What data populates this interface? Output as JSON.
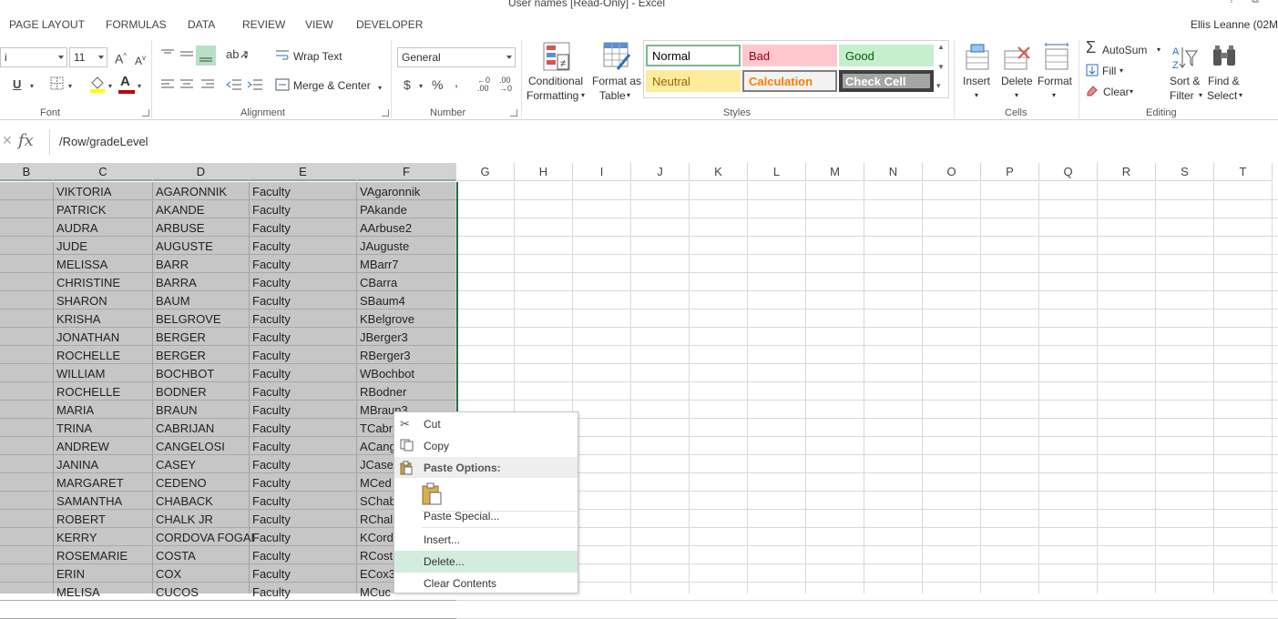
{
  "window": {
    "title": "User names  [Read-Only] - Excel",
    "help_glyph": "?",
    "restore_glyph": "⧉"
  },
  "ribbon_tabs": [
    "PAGE LAYOUT",
    "FORMULAS",
    "DATA",
    "REVIEW",
    "VIEW",
    "DEVELOPER"
  ],
  "user_name": "Ellis Leanne (02M",
  "font_group": {
    "font_name": "i",
    "font_size": "11",
    "label": "Font",
    "grow_label": "A",
    "shrink_label": "A",
    "underline_label": "U",
    "font_color_label": "A"
  },
  "alignment_group": {
    "wrap_text": "Wrap Text",
    "merge_center": "Merge & Center",
    "label": "Alignment"
  },
  "number_group": {
    "format": "General",
    "currency": "$",
    "percent": "%",
    "comma": ",",
    "label": "Number"
  },
  "styles_group": {
    "conditional_formatting": [
      "Conditional",
      "Formatting"
    ],
    "format_as_table": [
      "Format as",
      "Table"
    ],
    "cells": [
      {
        "label": "Normal",
        "bg": "#ffffff",
        "fg": "#000000",
        "border": "#7fb58f"
      },
      {
        "label": "Bad",
        "bg": "#ffc7ce",
        "fg": "#9c0006",
        "border": "#ffc7ce"
      },
      {
        "label": "Good",
        "bg": "#c6efce",
        "fg": "#006100",
        "border": "#c6efce"
      },
      {
        "label": "Neutral",
        "bg": "#ffeb9c",
        "fg": "#9c6500",
        "border": "#ffeb9c"
      },
      {
        "label": "Calculation",
        "bg": "#f2f2f2",
        "fg": "#fa7d00",
        "border": "#7f7f7f"
      },
      {
        "label": "Check Cell",
        "bg": "#a5a5a5",
        "fg": "#ffffff",
        "border": "#3f3f3f"
      }
    ],
    "label": "Styles"
  },
  "cells_group": {
    "insert": "Insert",
    "delete": "Delete",
    "format": "Format",
    "label": "Cells"
  },
  "editing_group": {
    "autosum": "AutoSum",
    "fill": "Fill",
    "clear": "Clear",
    "sort_filter": [
      "Sort &",
      "Filter"
    ],
    "find_select": [
      "Find &",
      "Select"
    ],
    "label": "Editing"
  },
  "formula_bar": {
    "cancel": "✕",
    "fx": "fx",
    "formula": "/Row/gradeLevel"
  },
  "columns": [
    "B",
    "C",
    "D",
    "E",
    "F",
    "G",
    "H",
    "I",
    "J",
    "K",
    "L",
    "M",
    "N",
    "O",
    "P",
    "Q",
    "R",
    "S",
    "T"
  ],
  "rows": [
    [
      "VIKTORIA",
      "AGARONNIK",
      "Faculty",
      "VAgaronnik"
    ],
    [
      "PATRICK",
      "AKANDE",
      "Faculty",
      "PAkande"
    ],
    [
      "AUDRA",
      "ARBUSE",
      "Faculty",
      "AArbuse2"
    ],
    [
      "JUDE",
      "AUGUSTE",
      "Faculty",
      "JAuguste"
    ],
    [
      "MELISSA",
      "BARR",
      "Faculty",
      "MBarr7"
    ],
    [
      "CHRISTINE",
      "BARRA",
      "Faculty",
      "CBarra"
    ],
    [
      "SHARON",
      "BAUM",
      "Faculty",
      "SBaum4"
    ],
    [
      "KRISHA",
      "BELGROVE",
      "Faculty",
      "KBelgrove"
    ],
    [
      "JONATHAN",
      "BERGER",
      "Faculty",
      "JBerger3"
    ],
    [
      "ROCHELLE",
      "BERGER",
      "Faculty",
      "RBerger3"
    ],
    [
      "WILLIAM",
      "BOCHBOT",
      "Faculty",
      "WBochbot"
    ],
    [
      "ROCHELLE",
      "BODNER",
      "Faculty",
      "RBodner"
    ],
    [
      "MARIA",
      "BRAUN",
      "Faculty",
      "MBraun3"
    ],
    [
      "TRINA",
      "CABRIJAN",
      "Faculty",
      "TCabr"
    ],
    [
      "ANDREW",
      "CANGELOSI",
      "Faculty",
      "ACang"
    ],
    [
      "JANINA",
      "CASEY",
      "Faculty",
      "JCasey"
    ],
    [
      "MARGARET",
      "CEDENO",
      "Faculty",
      "MCed"
    ],
    [
      "SAMANTHA",
      "CHABACK",
      "Faculty",
      "SChab"
    ],
    [
      "ROBERT",
      "CHALK  JR",
      "Faculty",
      "RChal"
    ],
    [
      "KERRY",
      "CORDOVA FOGAL",
      "Faculty",
      "KCord"
    ],
    [
      "ROSEMARIE",
      "COSTA",
      "Faculty",
      "RCost"
    ],
    [
      "ERIN",
      "COX",
      "Faculty",
      "ECox3"
    ],
    [
      "MELISA",
      "CUCOS",
      "Faculty",
      "MCuc"
    ]
  ],
  "context_menu": {
    "cut": "Cut",
    "copy": "Copy",
    "paste_options": "Paste Options:",
    "paste_special": "Paste Special...",
    "insert": "Insert...",
    "delete": "Delete...",
    "clear_contents": "Clear Contents"
  }
}
